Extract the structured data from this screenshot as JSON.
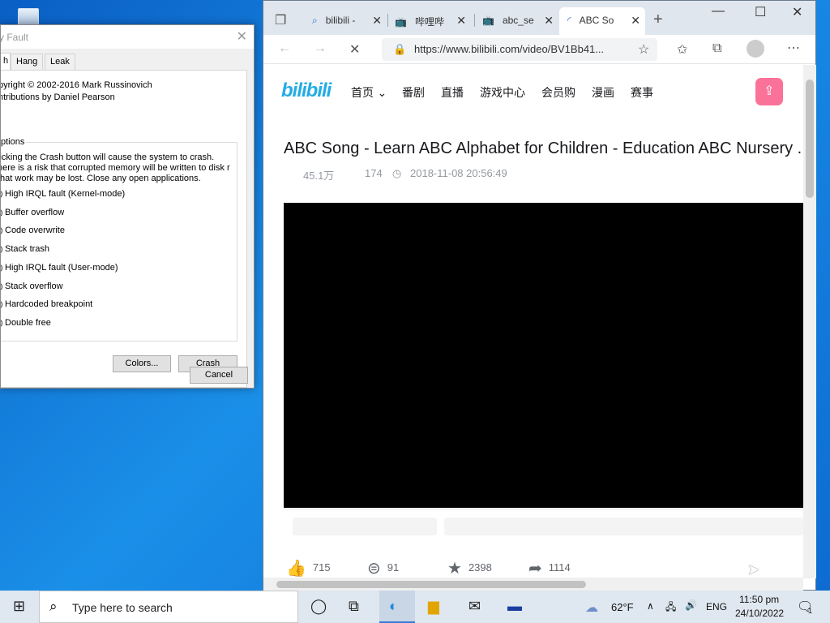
{
  "nmf": {
    "title": "y Fault",
    "tabs": [
      "h",
      "Hang",
      "Leak"
    ],
    "copyright": "pyright © 2002-2016 Mark Russinovich",
    "contrib": "ntributions by Daniel Pearson",
    "group_label": "ptions",
    "warning": "licking the Crash button will cause the system to crash. here is a risk that corrupted memory will be written to disk r that work may be lost. Close any open applications.",
    "options": [
      "High IRQL fault (Kernel-mode)",
      "Buffer overflow",
      "Code overwrite",
      "Stack trash",
      "High IRQL fault (User-mode)",
      "Stack overflow",
      "Hardcoded breakpoint",
      "Double free"
    ],
    "colors_btn": "Colors...",
    "crash_btn": "Crash",
    "cancel_btn": "Cancel"
  },
  "browser": {
    "tabs": [
      {
        "label": "bilibili -"
      },
      {
        "label": "哔哩哔"
      },
      {
        "label": "abc_se"
      },
      {
        "label": "ABC So"
      }
    ],
    "url": "https://www.bilibili.com/video/BV1Bb41..."
  },
  "site": {
    "logo": "bilibili",
    "nav": [
      "首页",
      "番剧",
      "直播",
      "游戏中心",
      "会员购",
      "漫画",
      "赛事"
    ],
    "video_title": "ABC Song - Learn ABC Alphabet for Children - Education ABC Nursery ...",
    "views": "45.1万",
    "danmaku": "174",
    "date": "2018-11-08 20:56:49",
    "likes": "715",
    "coins": "91",
    "favorites": "2398",
    "shares": "1114"
  },
  "taskbar": {
    "search_placeholder": "Type here to search",
    "weather": "62°F",
    "lang": "ENG",
    "time": "11:50 pm",
    "date": "24/10/2022",
    "notif": "1"
  }
}
